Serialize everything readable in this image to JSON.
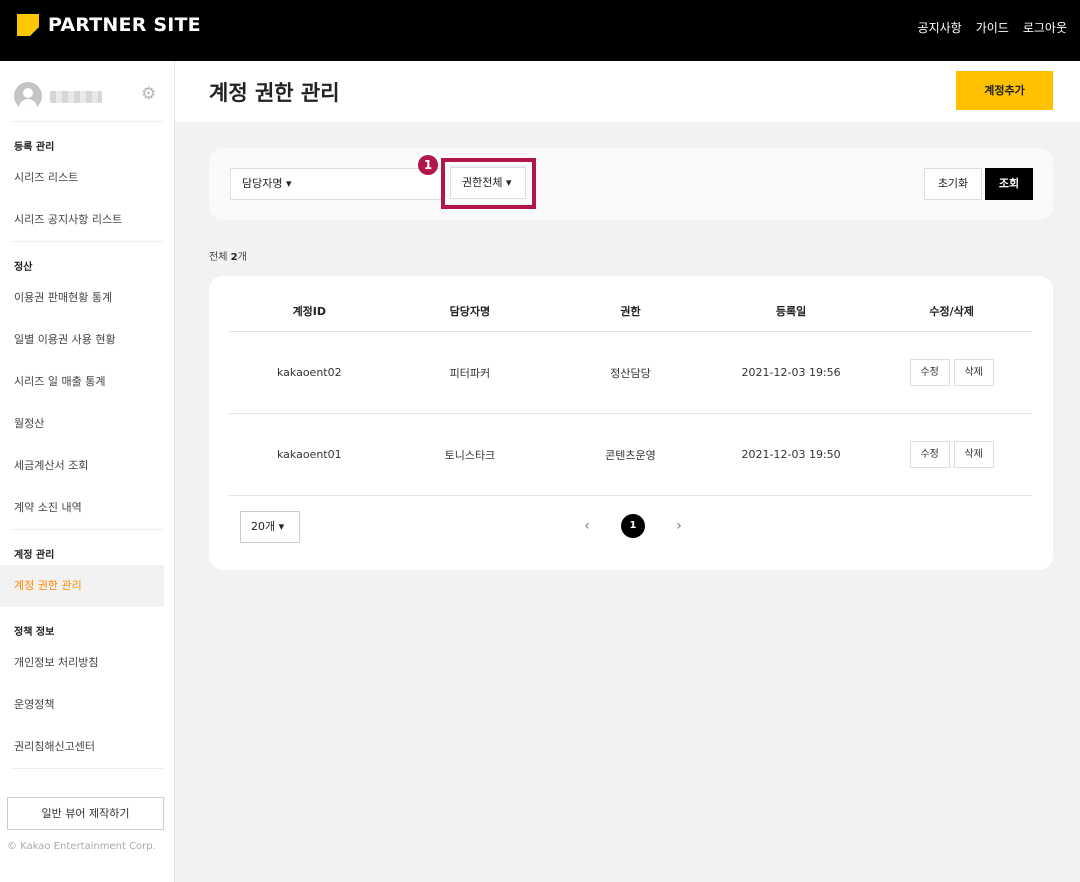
{
  "topbar": {
    "brand": "PARTNER SITE",
    "nav": [
      "공지사항",
      "가이드",
      "로그아웃"
    ]
  },
  "sidebar": {
    "sections": [
      {
        "title": "등록 관리",
        "items": [
          "시리즈 리스트",
          "시리즈 공지사항 리스트"
        ]
      },
      {
        "title": "정산",
        "items": [
          "이용권 판매현황 통계",
          "일별 이용권 사용 현황",
          "시리즈 일 매출 통계",
          "월정산",
          "세금계산서 조회",
          "계약 소진 내역"
        ]
      },
      {
        "title": "계정 관리",
        "items": [
          "계정 권한 관리"
        ],
        "active": "계정 권한 관리"
      },
      {
        "title": "정책 정보",
        "items": [
          "개인정보 처리방침",
          "운영정책",
          "권리침해신고센터"
        ]
      }
    ],
    "button": "일반 뷰어 제작하기",
    "copyright": "© Kakao Entertainment Corp."
  },
  "header": {
    "title": "계정 권한 관리",
    "add_button": "계정추가"
  },
  "filter": {
    "name_select": "담당자명",
    "auth_select": "권한전체",
    "marker": "1",
    "reset": "초기화",
    "search": "조회"
  },
  "total": {
    "prefix": "전체 ",
    "count": "2",
    "suffix": "개"
  },
  "table": {
    "columns": [
      "계정ID",
      "담당자명",
      "권한",
      "등록일",
      "수정/삭제"
    ],
    "rows": [
      {
        "id": "kakaoent02",
        "name": "피터파커",
        "role": "정산담당",
        "date": "2021-12-03 19:56"
      },
      {
        "id": "kakaoent01",
        "name": "토니스타크",
        "role": "콘텐츠운영",
        "date": "2021-12-03 19:50"
      }
    ],
    "edit_label": "수정",
    "delete_label": "삭제"
  },
  "pagination": {
    "page_size": "20개",
    "current": "1",
    "prev": "‹",
    "next": "›"
  },
  "colors": {
    "accent": "#ffc000",
    "active_menu": "#ff8a00",
    "highlight": "#b0154b"
  }
}
